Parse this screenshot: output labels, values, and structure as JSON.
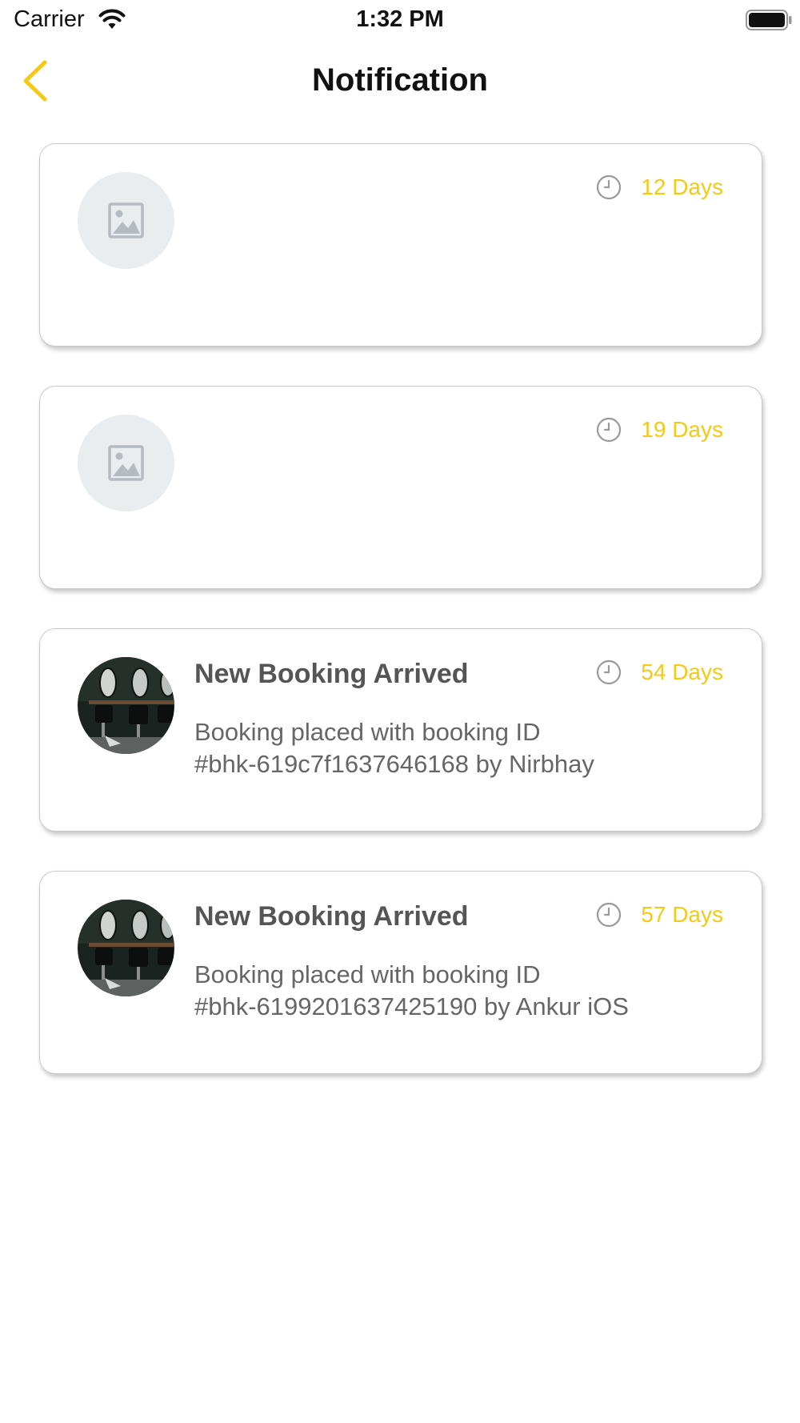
{
  "status_bar": {
    "carrier": "Carrier",
    "time": "1:32 PM"
  },
  "header": {
    "title": "Notification",
    "back_icon": "chevron-left-icon"
  },
  "colors": {
    "accent": "#f6c915",
    "placeholder_bg": "#e9edf0"
  },
  "notifications": [
    {
      "time": "12 Days",
      "avatar": "placeholder-image-icon",
      "title": "",
      "body_line1": "",
      "body_line2": ""
    },
    {
      "time": "19 Days",
      "avatar": "placeholder-image-icon",
      "title": "",
      "body_line1": "",
      "body_line2": ""
    },
    {
      "time": "54 Days",
      "avatar": "salon-photo",
      "title": "New Booking Arrived",
      "body_line1": "Booking placed with booking ID",
      "body_line2": "#bhk-619c7f1637646168 by Nirbhay"
    },
    {
      "time": "57 Days",
      "avatar": "salon-photo",
      "title": "New Booking Arrived",
      "body_line1": "Booking placed with booking ID",
      "body_line2": "#bhk-6199201637425190 by Ankur iOS"
    }
  ]
}
